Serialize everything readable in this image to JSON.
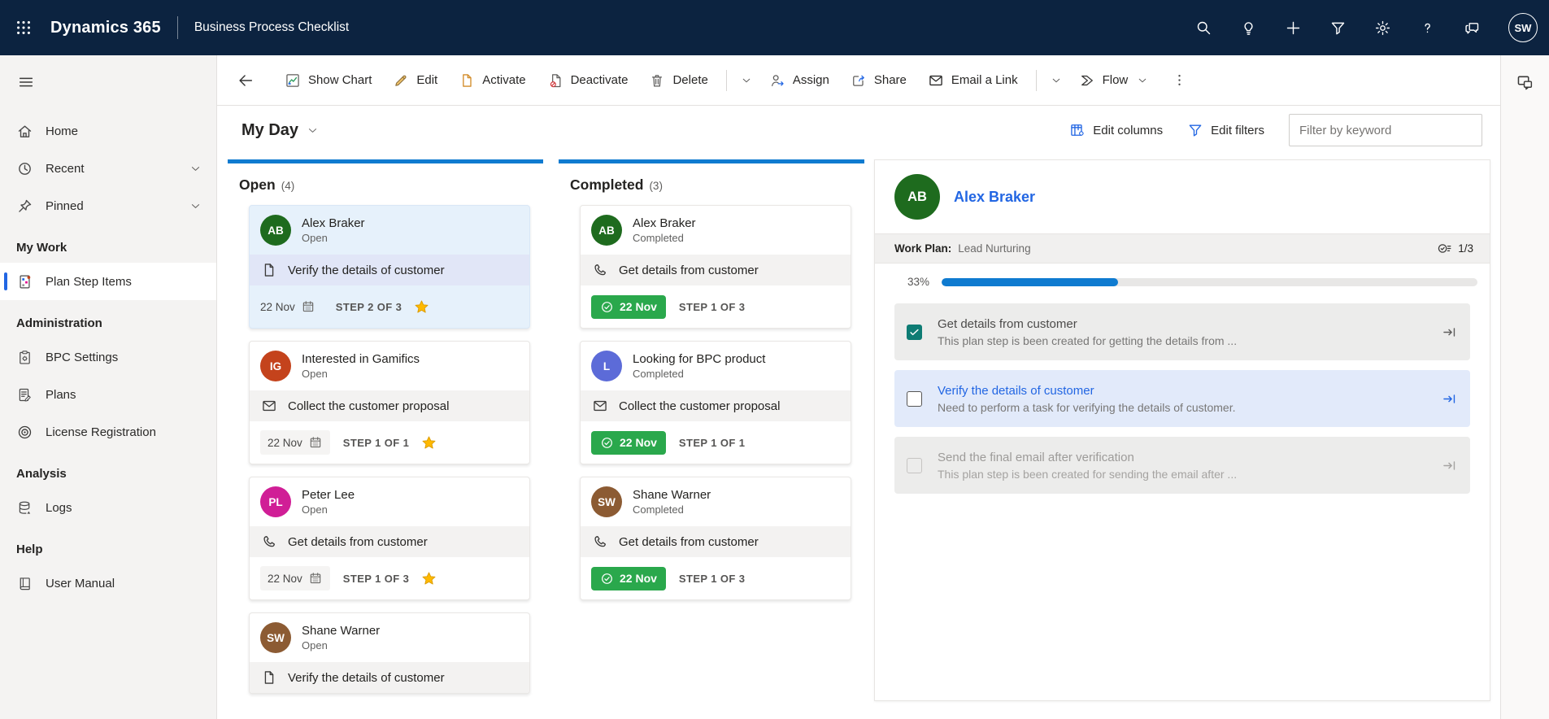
{
  "colors": {
    "accent": "#0f7bd0",
    "link": "#2266e3",
    "header_bg": "#0c2340",
    "green": "#2aa84c",
    "teal_checkbox": "#0e7c74",
    "star": "#ffb900"
  },
  "header": {
    "brand": "Dynamics 365",
    "app_title": "Business Process Checklist",
    "avatar_initials": "SW",
    "icons": [
      "waffle",
      "search",
      "lightbulb",
      "plus",
      "filter",
      "gear",
      "help",
      "chat"
    ]
  },
  "sidebar": {
    "groups": [
      {
        "items": [
          {
            "icon": "home",
            "label": "Home"
          },
          {
            "icon": "clock",
            "label": "Recent",
            "chevron": true
          },
          {
            "icon": "pin",
            "label": "Pinned",
            "chevron": true
          }
        ]
      },
      {
        "header": "My Work",
        "items": [
          {
            "icon": "plan-step",
            "label": "Plan Step Items",
            "selected": true
          }
        ]
      },
      {
        "header": "Administration",
        "items": [
          {
            "icon": "bpc-settings",
            "label": "BPC Settings"
          },
          {
            "icon": "plans",
            "label": "Plans"
          },
          {
            "icon": "license",
            "label": "License Registration"
          }
        ]
      },
      {
        "header": "Analysis",
        "items": [
          {
            "icon": "logs",
            "label": "Logs"
          }
        ]
      },
      {
        "header": "Help",
        "items": [
          {
            "icon": "book",
            "label": "User Manual"
          }
        ]
      }
    ]
  },
  "toolbar": {
    "items": [
      {
        "type": "button",
        "name": "show-chart-button",
        "icon": "chart",
        "label": "Show Chart"
      },
      {
        "type": "button",
        "name": "edit-button",
        "icon": "pencil",
        "label": "Edit"
      },
      {
        "type": "button",
        "name": "activate-button",
        "icon": "activate",
        "label": "Activate"
      },
      {
        "type": "button",
        "name": "deactivate-button",
        "icon": "deactivate",
        "label": "Deactivate"
      },
      {
        "type": "button",
        "name": "delete-button",
        "icon": "trash",
        "label": "Delete"
      },
      {
        "type": "divider"
      },
      {
        "type": "chevron",
        "name": "delete-overflow-chevron"
      },
      {
        "type": "button",
        "name": "assign-button",
        "icon": "assign",
        "label": "Assign"
      },
      {
        "type": "button",
        "name": "share-button",
        "icon": "share",
        "label": "Share"
      },
      {
        "type": "button",
        "name": "email-link-button",
        "icon": "mail",
        "label": "Email a Link"
      },
      {
        "type": "divider"
      },
      {
        "type": "chevron",
        "name": "email-overflow-chevron"
      },
      {
        "type": "button",
        "name": "flow-button",
        "icon": "flow",
        "label": "Flow",
        "chevron": true
      },
      {
        "type": "more",
        "name": "more-commands-button"
      }
    ]
  },
  "viewbar": {
    "title": "My Day",
    "edit_columns": "Edit columns",
    "edit_filters": "Edit filters",
    "filter_placeholder": "Filter by keyword"
  },
  "board": {
    "columns": [
      {
        "title": "Open",
        "count": "(4)",
        "cards": [
          {
            "initials": "AB",
            "avatar_color": "#1e6b1e",
            "name": "Alex Braker",
            "status": "Open",
            "task_icon": "doc",
            "task": "Verify the details of customer",
            "date": "22 Nov",
            "step": "STEP 2 OF 3",
            "star": true,
            "selected": true
          },
          {
            "initials": "IG",
            "avatar_color": "#c4431c",
            "name": "Interested in Gamifics",
            "status": "Open",
            "task_icon": "mail",
            "task": "Collect the customer proposal",
            "date": "22 Nov",
            "step": "STEP 1 OF 1",
            "star": true
          },
          {
            "initials": "PL",
            "avatar_color": "#d01e96",
            "name": "Peter Lee",
            "status": "Open",
            "task_icon": "phone",
            "task": "Get details from customer",
            "date": "22 Nov",
            "step": "STEP 1 OF 3",
            "star": true
          },
          {
            "initials": "SW",
            "avatar_color": "#8c5b33",
            "name": "Shane Warner",
            "status": "Open",
            "task_icon": "doc",
            "task": "Verify the details of customer"
          }
        ]
      },
      {
        "title": "Completed",
        "count": "(3)",
        "cards": [
          {
            "initials": "AB",
            "avatar_color": "#1e6b1e",
            "name": "Alex Braker",
            "status": "Completed",
            "task_icon": "phone",
            "task": "Get details from customer",
            "date": "22 Nov",
            "step": "STEP 1 OF 3",
            "completed": true
          },
          {
            "initials": "L",
            "avatar_color": "#5c6bd8",
            "name": "Looking for BPC product",
            "status": "Completed",
            "task_icon": "mail",
            "task": "Collect the customer proposal",
            "date": "22 Nov",
            "step": "STEP 1 OF 1",
            "completed": true
          },
          {
            "initials": "SW",
            "avatar_color": "#8c5b33",
            "name": "Shane Warner",
            "status": "Completed",
            "task_icon": "phone",
            "task": "Get details from customer",
            "date": "22 Nov",
            "step": "STEP 1 OF 3",
            "completed": true
          }
        ]
      }
    ]
  },
  "detail": {
    "initials": "AB",
    "avatar_color": "#1e6b1e",
    "name": "Alex Braker",
    "work_plan_label": "Work Plan:",
    "work_plan_value": "Lead Nurturing",
    "steps_count": "1/3",
    "progress_label": "33%",
    "progress_percent": 33,
    "steps": [
      {
        "checked": true,
        "title": "Get details from customer",
        "desc": "This plan step is been created for getting the details from ..."
      },
      {
        "checked": false,
        "highlight": true,
        "title": "Verify the details of customer",
        "desc": "Need to perform a task for verifying the details of customer."
      },
      {
        "checked": false,
        "disabled": true,
        "title": "Send the final email after verification",
        "desc": "This plan step is been created for sending the email after ..."
      }
    ]
  }
}
